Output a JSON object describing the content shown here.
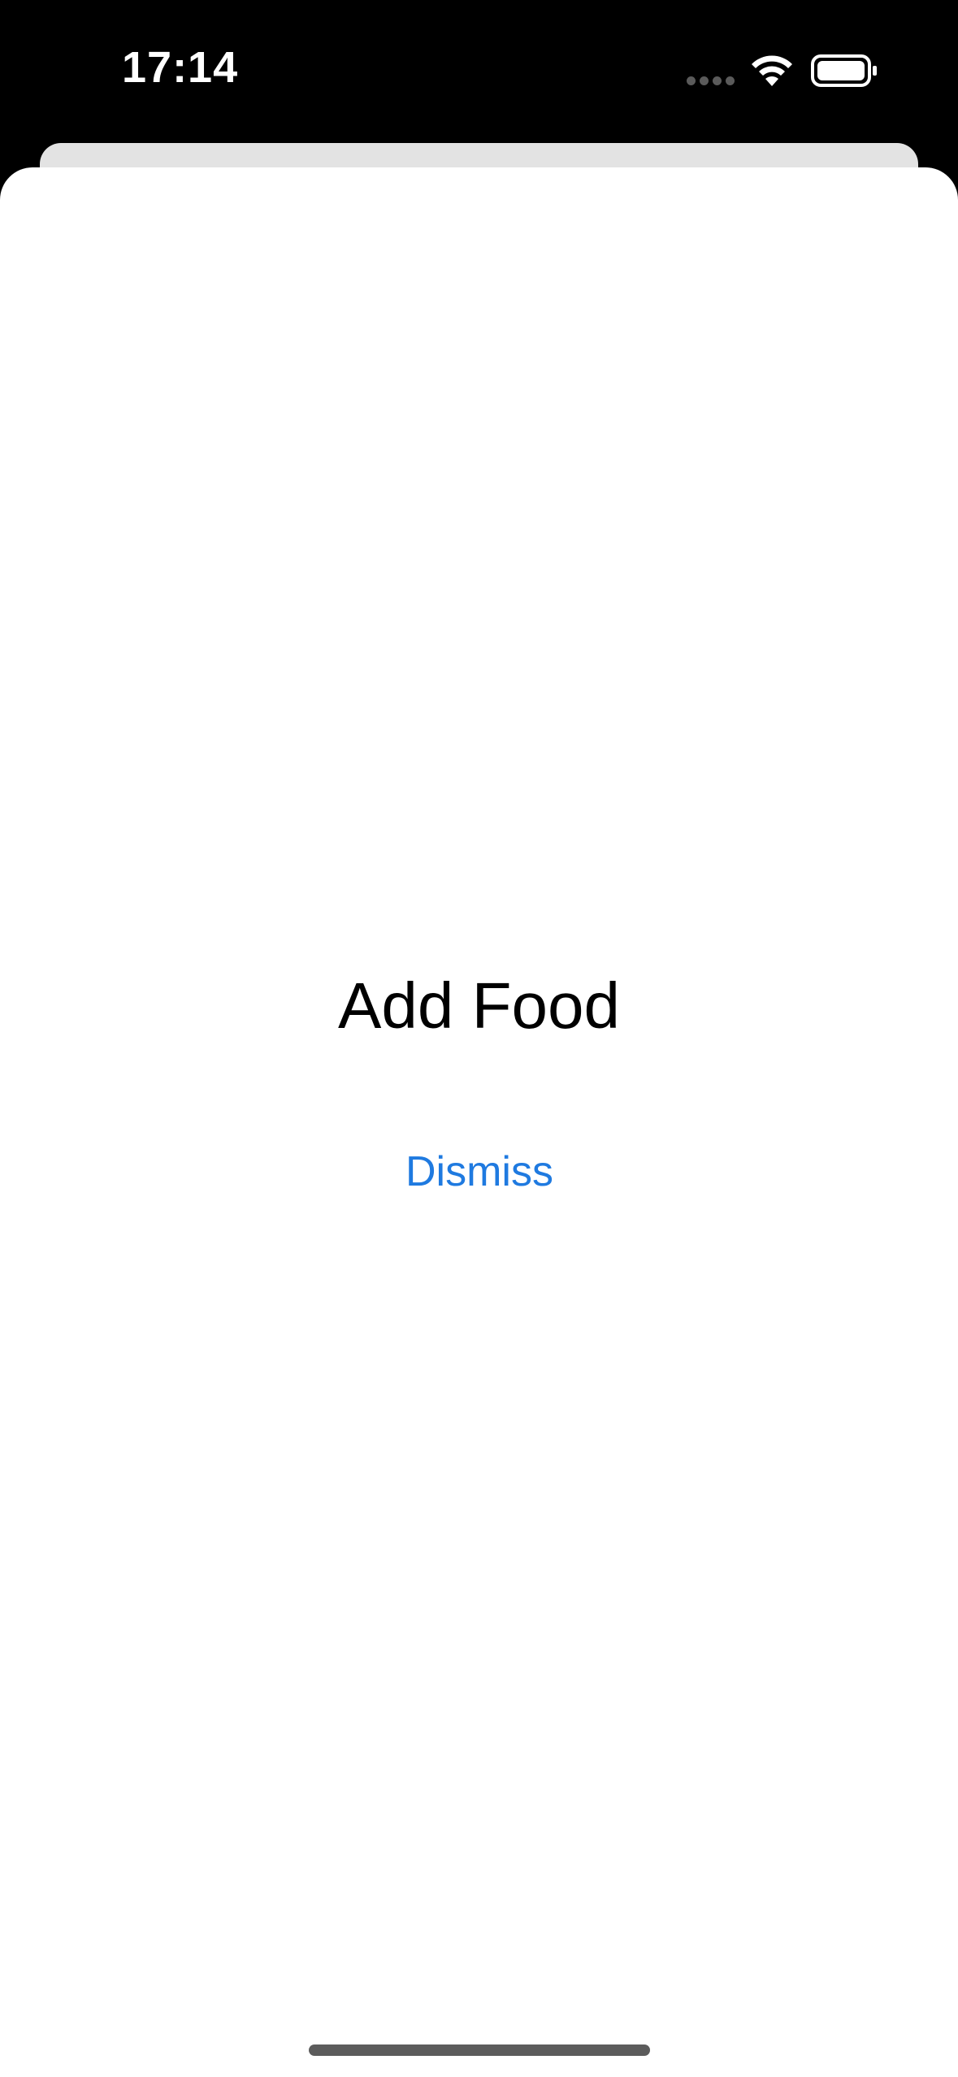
{
  "status_bar": {
    "time": "17:14",
    "signal_icon": "cellular-signal-dots-icon",
    "wifi_icon": "wifi-icon",
    "battery_icon": "battery-icon"
  },
  "sheet": {
    "title": "Add Food",
    "dismiss_label": "Dismiss"
  },
  "colors": {
    "accent": "#1f7ae0",
    "background": "#000000",
    "sheet": "#ffffff",
    "back_card": "#e3e3e3"
  }
}
